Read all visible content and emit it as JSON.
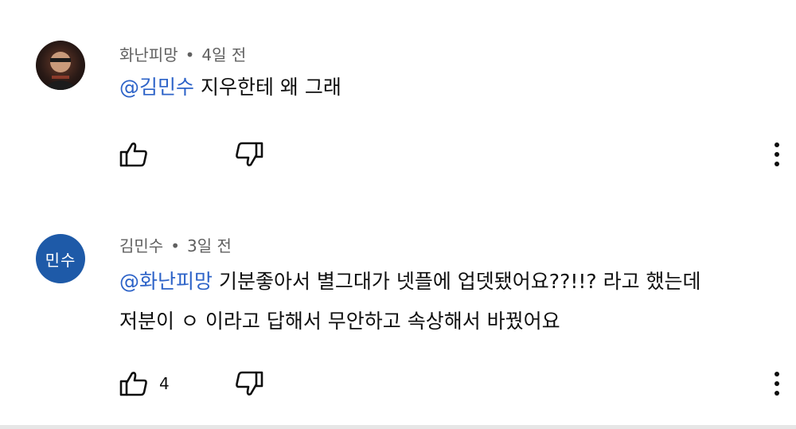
{
  "comments": [
    {
      "author": "화난피망",
      "time": "4일 전",
      "mention": "@김민수",
      "text_line1": " 지우한테 왜 그래",
      "text_line2": "",
      "like_count": "",
      "avatar_label": ""
    },
    {
      "author": "김민수",
      "time": "3일 전",
      "mention": "@화난피망",
      "text_line1": " 기분좋아서 별그대가 넷플에 업뎃됐어요??!!? 라고 했는데",
      "text_line2": "저분이 ㅇ 이라고 답해서 무안하고 속상해서 바꿨어요",
      "like_count": "4",
      "avatar_label": "민수",
      "avatar_color": "#1e5aa8"
    }
  ],
  "separator": "•",
  "icons": {
    "like": "thumbs-up-icon",
    "dislike": "thumbs-down-icon",
    "more": "more-vertical-icon"
  }
}
